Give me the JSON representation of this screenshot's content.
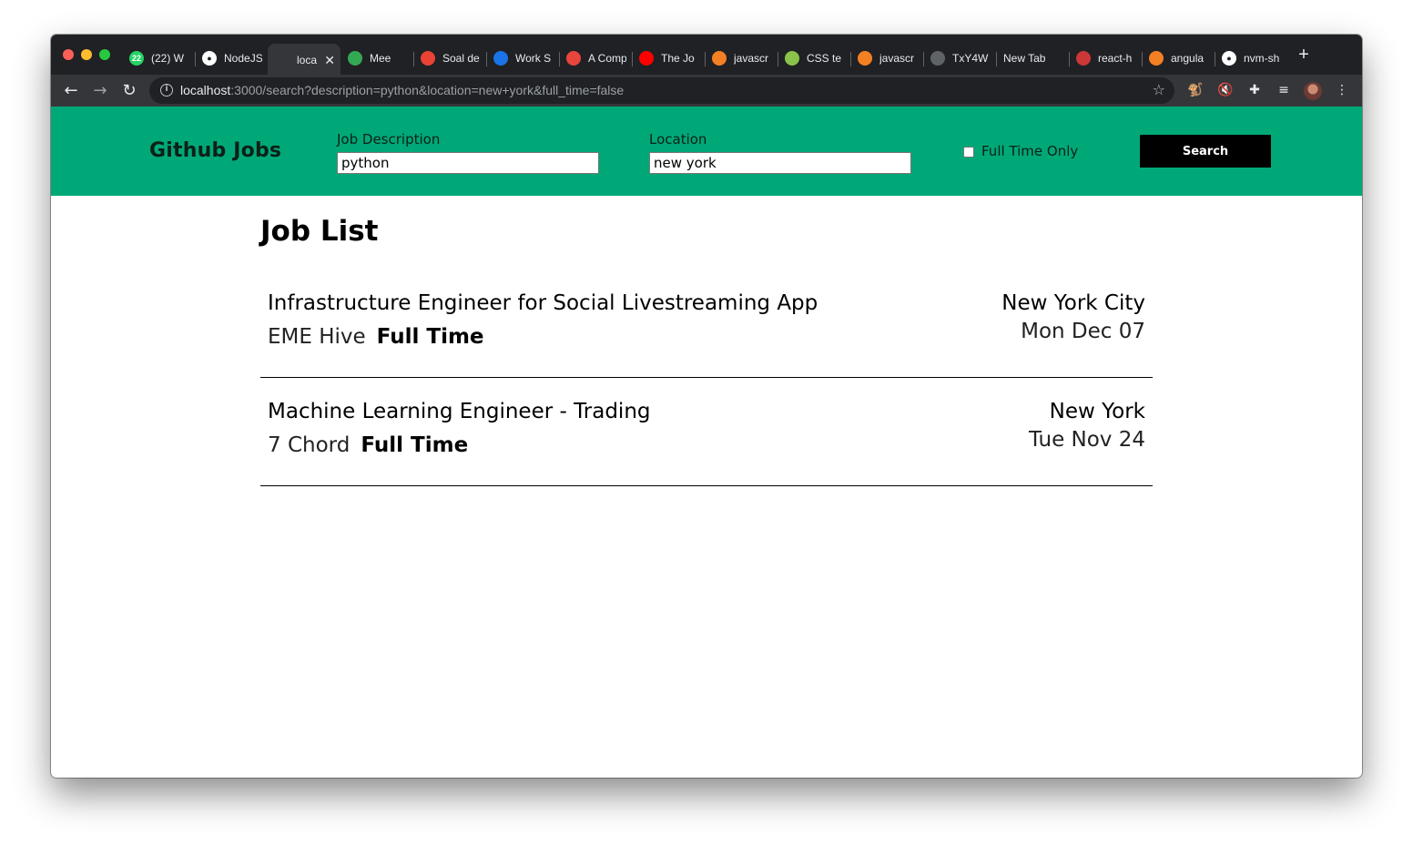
{
  "browser": {
    "tabs": [
      {
        "label": "(22) W",
        "icon": "whatsapp-icon",
        "color": "#25d366",
        "badge": "22"
      },
      {
        "label": "NodeJS",
        "icon": "github-icon",
        "color": "#ffffff"
      },
      {
        "label": "loca",
        "icon": "loading-icon",
        "color": "#5f6368",
        "active": true
      },
      {
        "label": "Mee",
        "icon": "meet-icon",
        "color": "#34a853"
      },
      {
        "label": "Soal de",
        "icon": "gmail-icon",
        "color": "#ea4335"
      },
      {
        "label": "Work S",
        "icon": "f-icon",
        "color": "#1a73e8"
      },
      {
        "label": "A Comp",
        "icon": "asterisk-icon",
        "color": "#e8453c"
      },
      {
        "label": "The Jo",
        "icon": "youtube-icon",
        "color": "#ff0000"
      },
      {
        "label": "javascr",
        "icon": "stackoverflow-icon",
        "color": "#f48024"
      },
      {
        "label": "CSS te",
        "icon": "css-icon",
        "color": "#8bc34a"
      },
      {
        "label": "javascr",
        "icon": "stackoverflow-icon",
        "color": "#f48024"
      },
      {
        "label": "TxY4W",
        "icon": "globe-icon",
        "color": "#5f6368"
      },
      {
        "label": "New Tab",
        "icon": "",
        "color": ""
      },
      {
        "label": "react-h",
        "icon": "npm-icon",
        "color": "#cb3837"
      },
      {
        "label": "angula",
        "icon": "stackoverflow-icon",
        "color": "#f48024"
      },
      {
        "label": "nvm-sh",
        "icon": "github-icon",
        "color": "#ffffff"
      }
    ],
    "url_host": "localhost",
    "url_rest": ":3000/search?description=python&location=new+york&full_time=false"
  },
  "app": {
    "brand": "Github Jobs",
    "description_label": "Job Description",
    "description_value": "python",
    "location_label": "Location",
    "location_value": "new york",
    "fulltime_label": "Full Time Only",
    "fulltime_checked": false,
    "search_label": "Search",
    "accent_color": "#00a878"
  },
  "job_list": {
    "title": "Job List",
    "jobs": [
      {
        "title": "Infrastructure Engineer for Social Livestreaming App",
        "company": "EME Hive",
        "type": "Full Time",
        "location": "New York City",
        "date": "Mon Dec 07"
      },
      {
        "title": "Machine Learning Engineer - Trading",
        "company": "7 Chord",
        "type": "Full Time",
        "location": "New York",
        "date": "Tue Nov 24"
      }
    ]
  }
}
